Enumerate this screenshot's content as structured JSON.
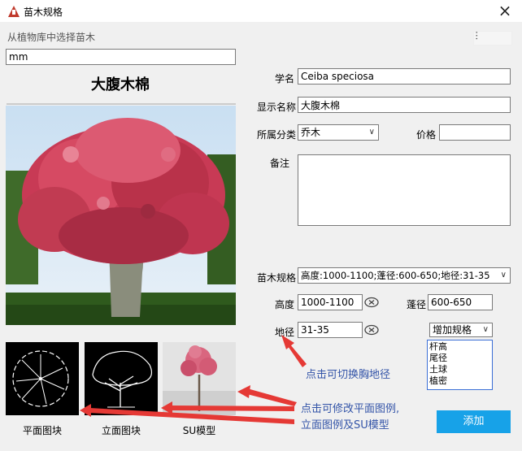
{
  "window": {
    "title": "苗木规格"
  },
  "library": {
    "section_label": "从植物库中选择苗木",
    "search_value": "mm",
    "plant_name": "大腹木棉"
  },
  "form": {
    "scientific_name_label": "学名",
    "scientific_name_value": "Ceiba speciosa",
    "display_name_label": "显示名称",
    "display_name_value": "大腹木棉",
    "category_label": "所属分类",
    "category_value": "乔木",
    "price_label": "价格",
    "price_value": "",
    "notes_label": "备注",
    "notes_value": "",
    "spec_label": "苗木规格",
    "spec_value": "高度:1000-1100;蓬径:600-650;地径:31-35",
    "height_label": "高度",
    "height_value": "1000-1100",
    "crown_label": "蓬径",
    "crown_value": "600-650",
    "base_diameter_label": "地径",
    "base_diameter_value": "31-35",
    "add_spec_label": "增加规格",
    "add_spec_options": [
      "杆高",
      "尾径",
      "土球",
      "植密"
    ]
  },
  "thumbnails": {
    "plan_label": "平面图块",
    "elevation_label": "立面图块",
    "su_label": "SU模型"
  },
  "actions": {
    "add_label": "添加"
  },
  "annotations": {
    "switch_diameter": "点击可切换胸地径",
    "modify_legends_line1": "点击可修改平面图例,",
    "modify_legends_line2": "立面图例及SU模型"
  },
  "colors": {
    "accent": "#17a2e8",
    "annotation_arrow": "#e53935",
    "annotation_text": "#3354a8"
  }
}
